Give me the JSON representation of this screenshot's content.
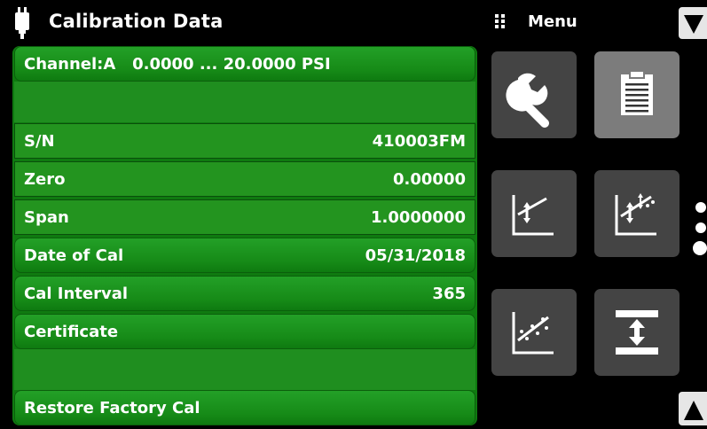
{
  "header": {
    "title": "Calibration Data",
    "menu_label": "Menu"
  },
  "panel": {
    "channel_range": "Channel:A   0.0000 ... 20.0000 PSI",
    "rows": [
      {
        "label": "S/N",
        "value": "410003FM"
      },
      {
        "label": "Zero",
        "value": "0.00000"
      },
      {
        "label": "Span",
        "value": "1.0000000"
      },
      {
        "label": "Date of Cal",
        "value": "05/31/2018"
      },
      {
        "label": "Cal Interval",
        "value": "365"
      }
    ],
    "certificate_label": "Certificate",
    "restore_label": "Restore Factory Cal"
  },
  "menu": {
    "tiles": [
      {
        "icon": "wrench-icon",
        "active": false
      },
      {
        "icon": "clipboard-icon",
        "active": true
      },
      {
        "icon": "two-point-cal-icon",
        "active": false
      },
      {
        "icon": "multi-point-cal-icon",
        "active": false
      },
      {
        "icon": "linearization-icon",
        "active": false
      },
      {
        "icon": "range-adjust-icon",
        "active": false
      }
    ],
    "page_indicator": {
      "pages": 3,
      "current": 3
    }
  },
  "colors": {
    "panel_green": "#0f7a10",
    "row_green": "#23941f",
    "tile_gray": "#444444",
    "tile_active_gray": "#7c7c7c",
    "background": "#000000"
  }
}
